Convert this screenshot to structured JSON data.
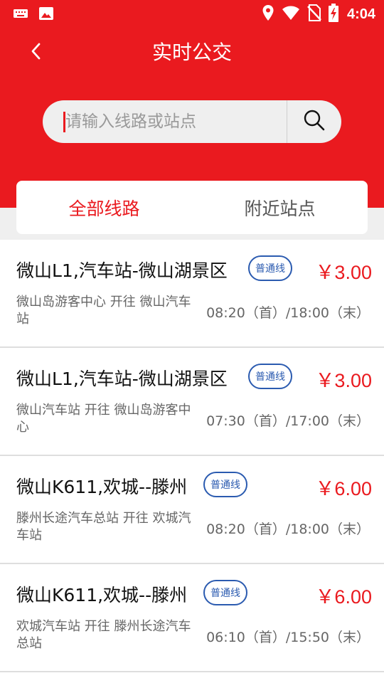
{
  "status_bar": {
    "time": "4:04",
    "icons": [
      "keyboard-icon",
      "image-icon",
      "location-icon",
      "wifi-icon",
      "no-sim-icon",
      "battery-charging-icon"
    ]
  },
  "header": {
    "title": "实时公交",
    "back_icon": "chevron-left-icon"
  },
  "search": {
    "placeholder": "请输入线路或站点",
    "icon": "search-icon"
  },
  "tabs": [
    {
      "label": "全部线路",
      "active": true
    },
    {
      "label": "附近站点",
      "active": false
    }
  ],
  "colors": {
    "accent": "#ea1a1f",
    "badge": "#2b5bb0"
  },
  "routes": [
    {
      "name": "微山L1,汽车站-微山湖景区",
      "type": "普通线",
      "price": "￥3.00",
      "description": "微山岛游客中心 开往 微山汽车站",
      "hours": "08:20（首）/18:00（末）"
    },
    {
      "name": "微山L1,汽车站-微山湖景区",
      "type": "普通线",
      "price": "￥3.00",
      "description": "微山汽车站 开往 微山岛游客中心",
      "hours": "07:30（首）/17:00（末）"
    },
    {
      "name": "微山K611,欢城--滕州",
      "type": "普通线",
      "price": "￥6.00",
      "description": "滕州长途汽车总站 开往 欢城汽车站",
      "hours": "08:20（首）/18:00（末）"
    },
    {
      "name": "微山K611,欢城--滕州",
      "type": "普通线",
      "price": "￥6.00",
      "description": "欢城汽车站 开往 滕州长途汽车总站",
      "hours": "06:10（首）/15:50（末）"
    }
  ]
}
